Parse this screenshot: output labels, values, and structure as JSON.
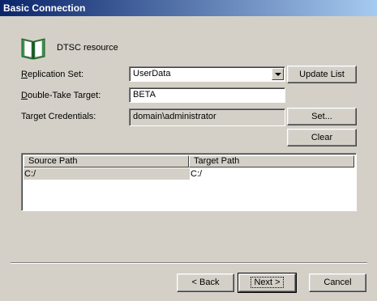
{
  "window": {
    "title": "Basic Connection"
  },
  "resource": {
    "label": "DTSC resource"
  },
  "form": {
    "replication_set_label": "Replication Set:",
    "replication_set_value": "UserData",
    "double_take_target_label": "Double-Take Target:",
    "double_take_target_value": "BETA",
    "target_credentials_label": "Target Credentials:",
    "target_credentials_value": "domain\\administrator"
  },
  "buttons": {
    "update_list": "Update List",
    "set": "Set...",
    "clear": "Clear",
    "back": "< Back",
    "next": "Next >",
    "cancel": "Cancel"
  },
  "table": {
    "columns": [
      "Source Path",
      "Target Path"
    ],
    "rows": [
      {
        "source": "C:/",
        "target": "C:/"
      }
    ]
  },
  "colors": {
    "title_start": "#0a246a",
    "title_end": "#a6caf0",
    "face": "#d4d0c8",
    "icon_green": "#1f7a2e"
  },
  "icons": {
    "resource": "book-icon"
  }
}
